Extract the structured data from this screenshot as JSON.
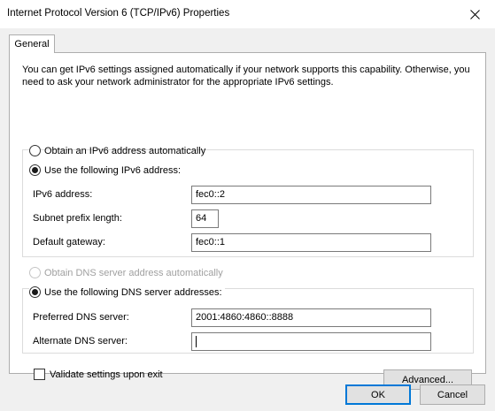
{
  "window": {
    "title": "Internet Protocol Version 6 (TCP/IPv6) Properties",
    "close_glyph": "✕"
  },
  "tabs": [
    {
      "label": "General",
      "selected": true
    }
  ],
  "intro_text": "You can get IPv6 settings assigned automatically if your network supports this capability. Otherwise, you need to ask your network administrator for the appropriate IPv6 settings.",
  "ip_section": {
    "auto_option": {
      "label": "Obtain an IPv6 address automatically",
      "checked": false
    },
    "manual_option": {
      "label": "Use the following IPv6 address:",
      "checked": true
    },
    "fields": [
      {
        "label": "IPv6 address:",
        "value": "fec0::2"
      },
      {
        "label": "Subnet prefix length:",
        "value": "64"
      },
      {
        "label": "Default gateway:",
        "value": "fec0::1"
      }
    ]
  },
  "dns_section": {
    "auto_option": {
      "label": "Obtain DNS server address automatically",
      "checked": false,
      "disabled": true
    },
    "manual_option": {
      "label": "Use the following DNS server addresses:",
      "checked": true
    },
    "fields": [
      {
        "label": "Preferred DNS server:",
        "value": "2001:4860:4860::8888"
      },
      {
        "label": "Alternate DNS server:",
        "value": ""
      }
    ]
  },
  "validate_checkbox": {
    "label": "Validate settings upon exit",
    "checked": false
  },
  "buttons": {
    "advanced": "Advanced...",
    "ok": "OK",
    "cancel": "Cancel"
  },
  "colors": {
    "accent": "#0078d7",
    "title_edge": "#e81123",
    "client_bg": "#f0f0f0"
  }
}
